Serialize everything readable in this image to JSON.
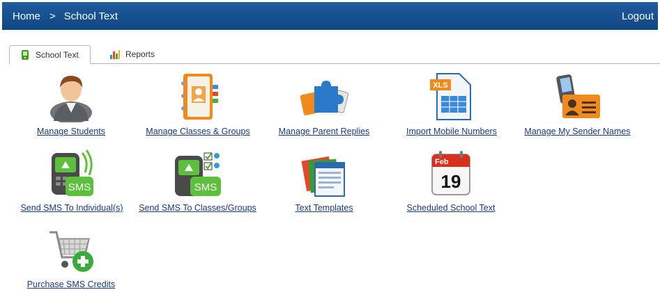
{
  "header": {
    "breadcrumb_home": "Home",
    "breadcrumb_separator": ">",
    "breadcrumb_current": "School Text",
    "logout": "Logout",
    "bar_color": "#144f8f"
  },
  "tabs": [
    {
      "label": "School Text",
      "icon": "phone-icon",
      "active": true
    },
    {
      "label": "Reports",
      "icon": "bar-chart-icon",
      "active": false
    }
  ],
  "items": [
    {
      "label": "Manage Students",
      "icon": "person-icon"
    },
    {
      "label": "Manage Classes & Groups",
      "icon": "address-book-icon"
    },
    {
      "label": "Manage Parent Replies",
      "icon": "puzzle-cards-icon"
    },
    {
      "label": "Import Mobile Numbers",
      "icon": "xls-file-icon"
    },
    {
      "label": "Manage My Sender Names",
      "icon": "id-card-phone-icon"
    },
    {
      "label": "Send SMS To Individual(s)",
      "icon": "sms-phone-icon"
    },
    {
      "label": "Send SMS To Classes/Groups",
      "icon": "sms-group-icon"
    },
    {
      "label": "Text Templates",
      "icon": "templates-icon"
    },
    {
      "label": "Scheduled School Text",
      "icon": "calendar-icon",
      "calendar_month": "Feb",
      "calendar_day": "19"
    },
    {
      "label": "Purchase SMS Credits",
      "icon": "cart-plus-icon"
    }
  ]
}
